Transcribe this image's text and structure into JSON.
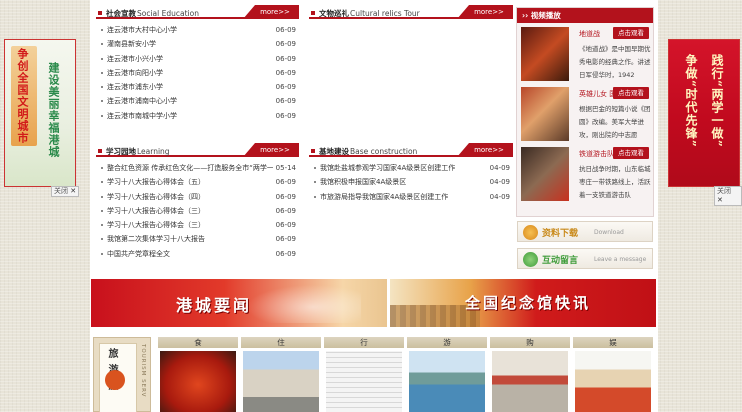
{
  "colors": {
    "accent": "#b3121c",
    "background": "#e8e4d8"
  },
  "left_banner": {
    "text_a": "争创全国文明城市",
    "text_b": "建设美丽幸福港城",
    "close_label": "关闭"
  },
  "right_banner": {
    "text_a": "践行“两学一做”",
    "text_b": "争做“时代先锋”",
    "close_label": "关闭"
  },
  "social_education": {
    "title_cn": "社会宣教",
    "title_en": "Social Education",
    "more_label": "more>>",
    "items": [
      {
        "title": "连云港市大村中心小学",
        "date": "06-09"
      },
      {
        "title": "灌南县新安小学",
        "date": "06-09"
      },
      {
        "title": "连云港市小兴小学",
        "date": "06-09"
      },
      {
        "title": "连云港市向阳小学",
        "date": "06-09"
      },
      {
        "title": "连云港市浦东小学",
        "date": "06-09"
      },
      {
        "title": "连云港市浦南中心小学",
        "date": "06-09"
      },
      {
        "title": "连云港市南城中学小学",
        "date": "06-09"
      }
    ]
  },
  "cultural_relics": {
    "title_cn": "文物巡礼",
    "title_en": "Cultural relics Tour",
    "more_label": "more>>"
  },
  "learning": {
    "title_cn": "学习园地",
    "title_en": "Learning",
    "more_label": "more>>",
    "items": [
      {
        "title": "整合红色资源 传承红色文化——打造服务全市“两学一",
        "date": "05-14"
      },
      {
        "title": "学习十八大报告心得体会（五）",
        "date": "06-09"
      },
      {
        "title": "学习十八大报告心得体会（四）",
        "date": "06-09"
      },
      {
        "title": "学习十八大报告心得体会（三）",
        "date": "06-09"
      },
      {
        "title": "学习十八大报告心得体会（三）",
        "date": "06-09"
      },
      {
        "title": "我馆第二次集体学习十八大报告",
        "date": "06-09"
      },
      {
        "title": "中国共产党章程全文",
        "date": "06-09"
      }
    ]
  },
  "base_construction": {
    "title_cn": "基地建设",
    "title_en": "Base construction",
    "more_label": "more>>",
    "items": [
      {
        "title": "我馆赴盐城参观学习国家4A级景区创建工作",
        "date": "04-09"
      },
      {
        "title": "我馆积极申报国家4A级景区",
        "date": "04-09"
      },
      {
        "title": "市旅游局指导我馆国家4A级景区创建工作",
        "date": "04-09"
      }
    ]
  },
  "video": {
    "header": "视频播放",
    "button_label": "点击观看",
    "items": [
      {
        "title": "地道战",
        "desc": "《地道战》是中国早期优秀电影的经典之作。讲述日军侵华时，1942"
      },
      {
        "title": "英雄儿女 国",
        "desc": "根据巴金的短篇小说《团圆》改编。美军大举进攻，刚出院的中志愿"
      },
      {
        "title": "铁道游击队",
        "desc": "抗日战争时期，山东临城枣庄一带铁路线上，活跃着一支铁道游击队"
      }
    ]
  },
  "side_buttons": [
    {
      "cn": "资料下载",
      "en": "Download"
    },
    {
      "cn": "互动留言",
      "en": "Leave a message"
    }
  ],
  "banners": {
    "left": "港城要闻",
    "right": "全国纪念馆快讯"
  },
  "tourism": {
    "label_cn": "旅游服",
    "label_en": "TOURISM SERV",
    "categories": [
      "食",
      "住",
      "行",
      "游",
      "购",
      "娱"
    ]
  }
}
